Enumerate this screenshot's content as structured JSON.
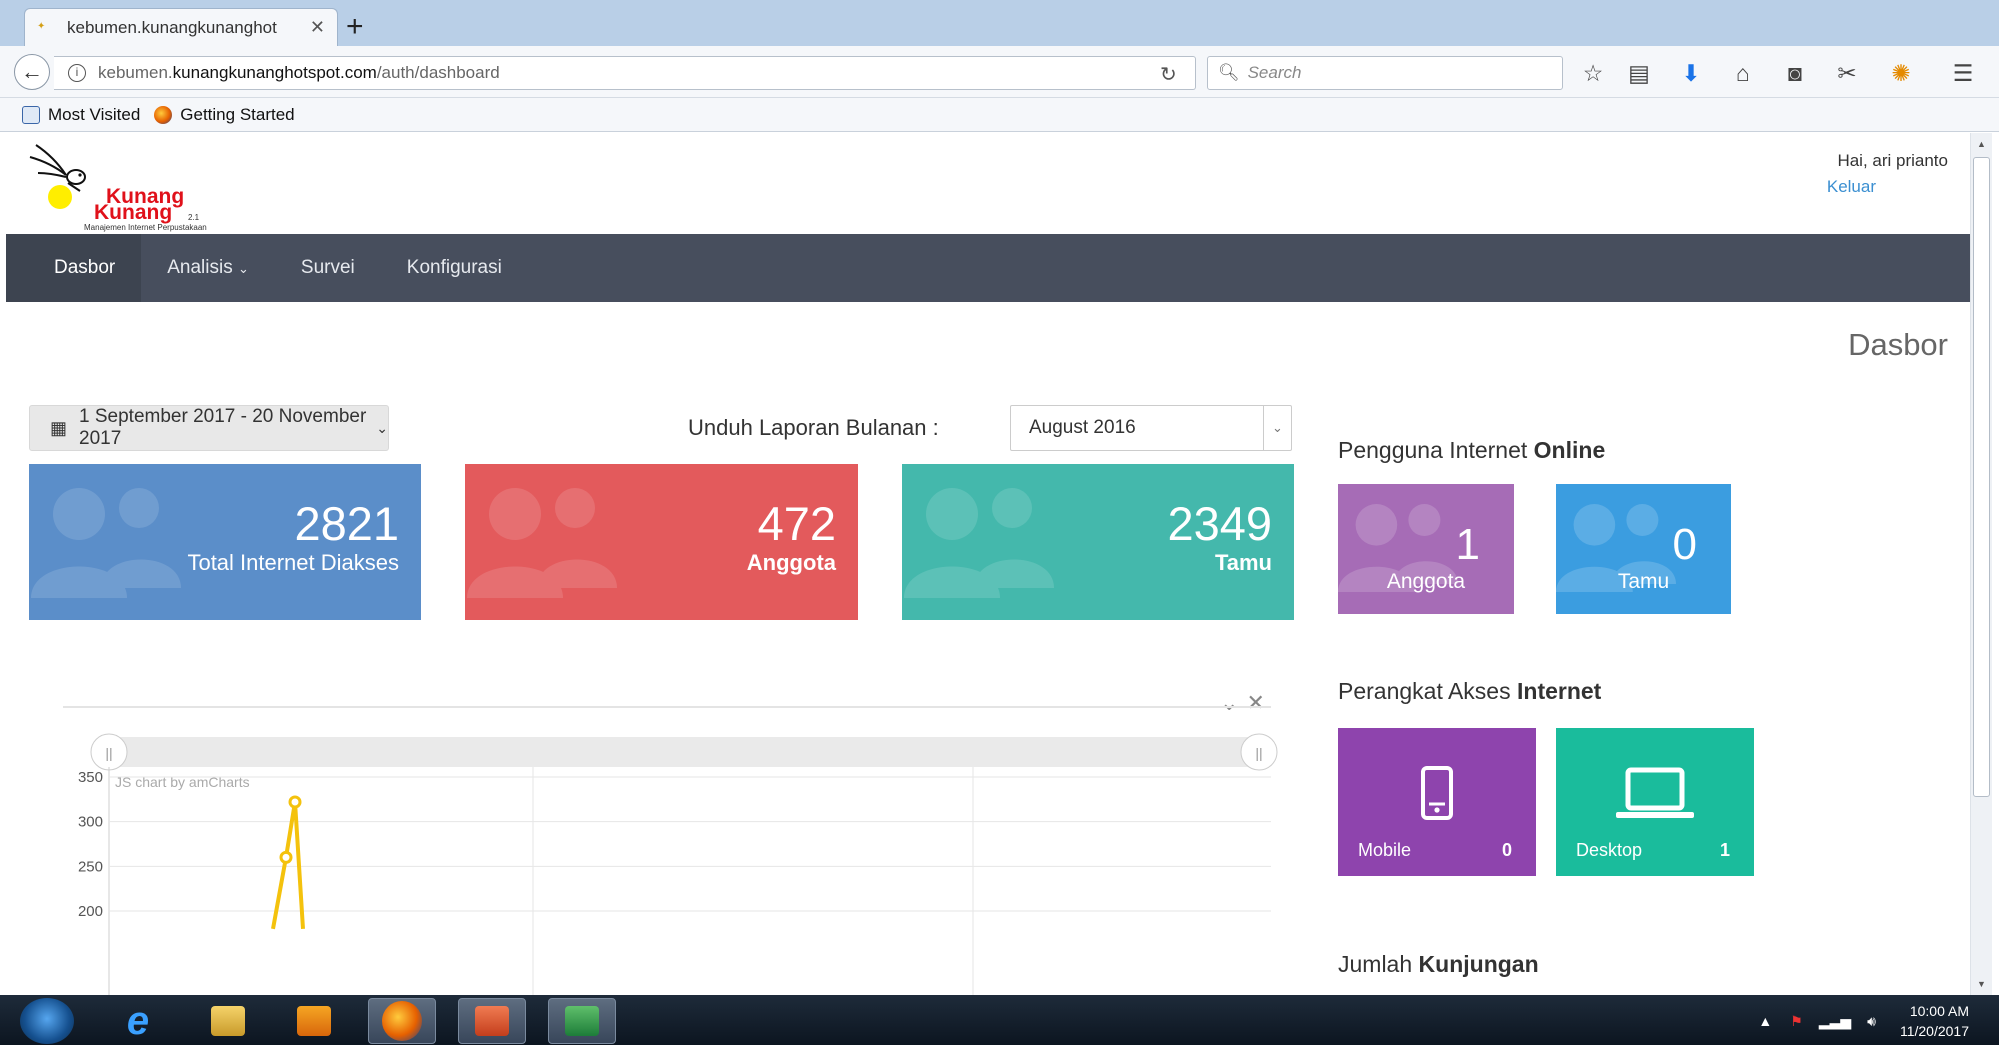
{
  "browser": {
    "tab_title": "kebumen.kunangkunanghot",
    "url_prefix": "kebumen.",
    "url_domain": "kunangkunanghotspot.com",
    "url_path": "/auth/dashboard",
    "search_placeholder": "Search",
    "bookmarks": [
      {
        "label": "Most Visited"
      },
      {
        "label": "Getting Started"
      }
    ]
  },
  "site": {
    "logo_line1": "Kunang",
    "logo_line2": "Kunang",
    "logo_version": "2.1",
    "logo_tagline": "Manajemen Internet Perpustakaan",
    "greeting": "Hai, ari prianto",
    "logout": "Keluar"
  },
  "nav": {
    "items": [
      {
        "label": "Dasbor",
        "active": true
      },
      {
        "label": "Analisis",
        "dropdown": true
      },
      {
        "label": "Survei"
      },
      {
        "label": "Konfigurasi"
      }
    ]
  },
  "page_title": "Dasbor",
  "filters": {
    "date_range": "1 September 2017 - 20 November 2017",
    "download_label": "Unduh Laporan Bulanan :",
    "month_selected": "August 2016"
  },
  "stats": [
    {
      "value": "2821",
      "label": "Total Internet Diakses",
      "color": "#5b8ec9"
    },
    {
      "value": "472",
      "label": "Anggota",
      "color": "#e35a5c"
    },
    {
      "value": "2349",
      "label": "Tamu",
      "color": "#44b8ac"
    }
  ],
  "online": {
    "title_prefix": "Pengguna Internet",
    "title_bold": "Online",
    "boxes": [
      {
        "value": "1",
        "label": "Anggota",
        "color": "#a66cb6"
      },
      {
        "value": "0",
        "label": "Tamu",
        "color": "#3b9de0"
      }
    ]
  },
  "devices": {
    "title_prefix": "Perangkat Akses",
    "title_bold": "Internet",
    "boxes": [
      {
        "label": "Mobile",
        "count": "0",
        "icon": "mobile-icon",
        "color": "#8e44ad"
      },
      {
        "label": "Desktop",
        "count": "1",
        "icon": "desktop-icon",
        "color": "#1abc9c"
      }
    ]
  },
  "visits": {
    "title_prefix": "Jumlah",
    "title_bold": "Kunjungan"
  },
  "chart_data": {
    "type": "line",
    "credit": "JS chart by amCharts",
    "y_ticks": [
      "350",
      "300",
      "250",
      "200"
    ],
    "ylim": [
      200,
      350
    ],
    "series": [
      {
        "color": "#f4c20d",
        "values": [
          180,
          260,
          322,
          180
        ]
      }
    ],
    "grid": true
  },
  "taskbar": {
    "time": "10:00 AM",
    "date": "11/20/2017"
  }
}
